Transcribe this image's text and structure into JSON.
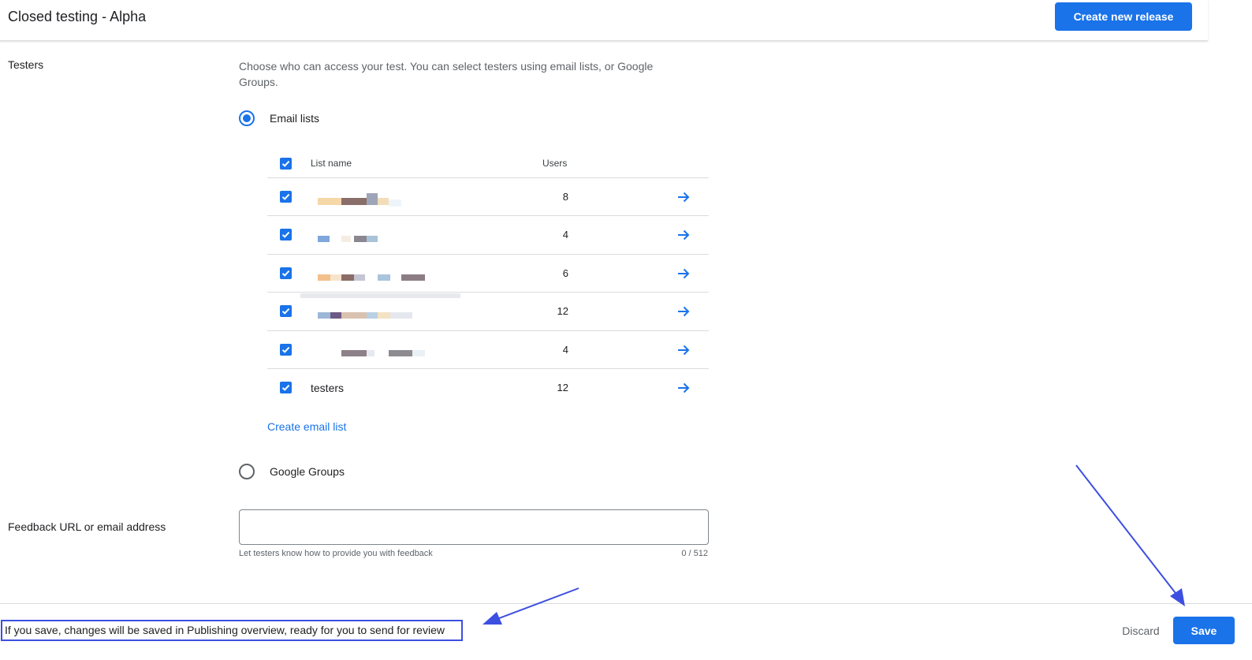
{
  "header": {
    "title": "Closed testing - Alpha",
    "create_release_label": "Create new release"
  },
  "testers": {
    "label": "Testers",
    "description": "Choose who can access your test. You can select testers using email lists, or Google Groups.",
    "email_lists_option": "Email lists",
    "google_groups_option": "Google Groups",
    "selected_option": "Email lists",
    "table": {
      "col_list_name": "List name",
      "col_users": "Users",
      "rows": [
        {
          "name": "",
          "users": "8",
          "checked": true,
          "name_obscured": true
        },
        {
          "name": "",
          "users": "4",
          "checked": true,
          "name_obscured": true
        },
        {
          "name": "",
          "users": "6",
          "checked": true,
          "name_obscured": true
        },
        {
          "name": "",
          "users": "12",
          "checked": true,
          "name_obscured": true
        },
        {
          "name": "",
          "users": "4",
          "checked": true,
          "name_obscured": true
        },
        {
          "name": "testers",
          "users": "12",
          "checked": true,
          "name_obscured": false
        }
      ]
    },
    "create_email_list_label": "Create email list"
  },
  "feedback": {
    "label": "Feedback URL or email address",
    "value": "",
    "helper_text": "Let testers know how to provide you with feedback",
    "counter": "0 / 512"
  },
  "footer": {
    "note": "If you save, changes will be saved in Publishing overview, ready for you to send for review",
    "discard_label": "Discard",
    "save_label": "Save"
  },
  "colors": {
    "accent": "#1a73e8",
    "annotation": "#3d4fe0",
    "text": "#202124",
    "secondary_text": "#5f6368",
    "divider": "#dadce0"
  }
}
